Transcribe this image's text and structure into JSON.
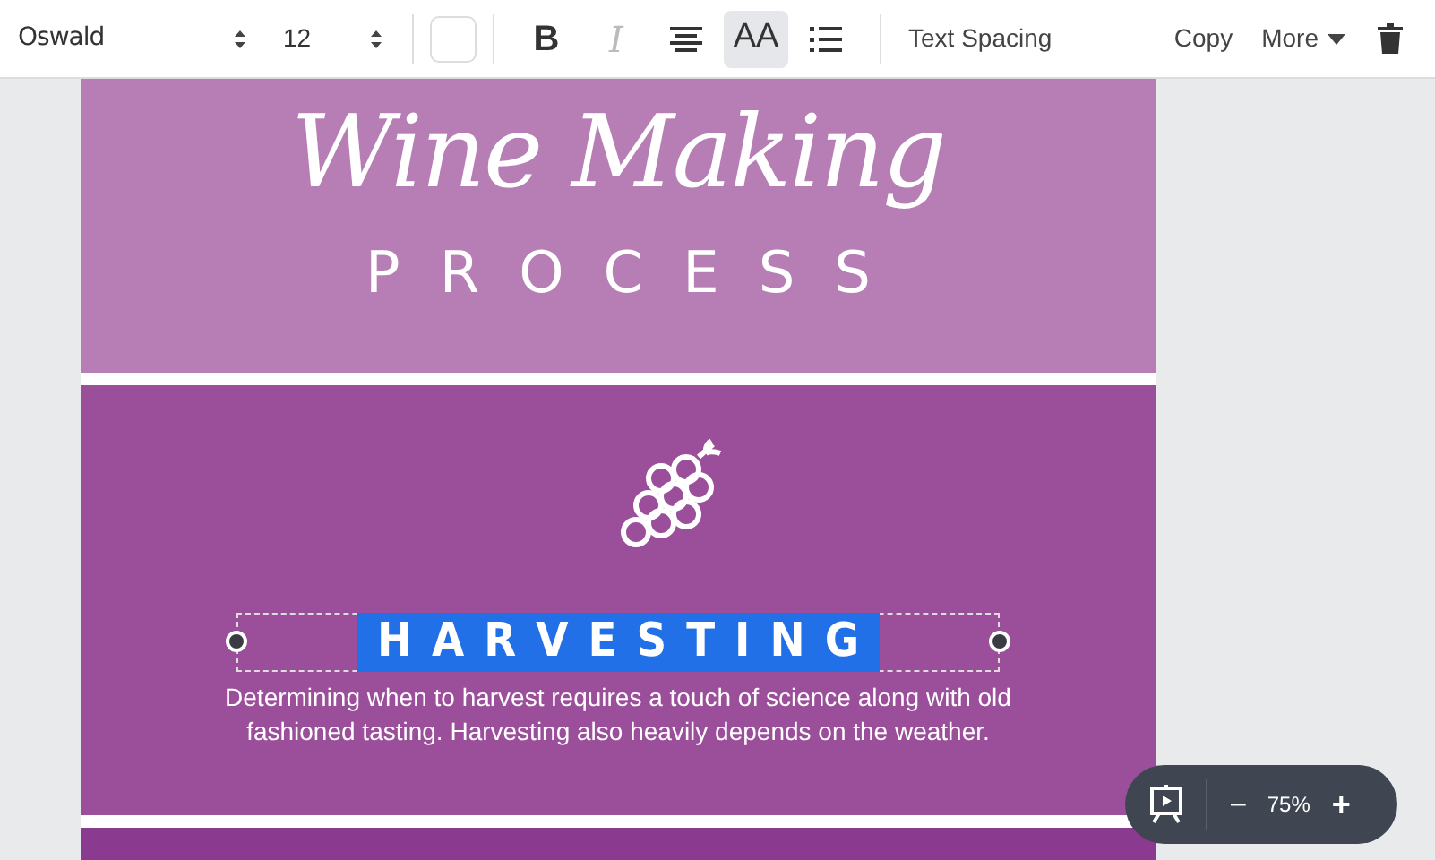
{
  "toolbar": {
    "font": "Oswald",
    "font_size": "12",
    "format_buttons": [
      {
        "kind": "bold",
        "label": "B",
        "disabled": false,
        "selected": false
      },
      {
        "kind": "italic",
        "label": "I",
        "disabled": true,
        "selected": false
      },
      {
        "kind": "align",
        "disabled": false,
        "selected": false
      },
      {
        "kind": "case",
        "label": "AA",
        "disabled": false,
        "selected": true
      },
      {
        "kind": "list",
        "disabled": false,
        "selected": false
      }
    ],
    "text_spacing": "Text Spacing",
    "copy": "Copy",
    "more": "More"
  },
  "canvas": {
    "title": "Wine Making",
    "subtitle": "PROCESS",
    "section": {
      "heading": "HARVESTING",
      "heading_selected": true,
      "body": "Determining when to harvest requires a touch of science along with old fashioned tasting. Harvesting also heavily depends on the weather."
    }
  },
  "zoom": {
    "level_text": "75%",
    "minus": "–",
    "plus": "+"
  }
}
